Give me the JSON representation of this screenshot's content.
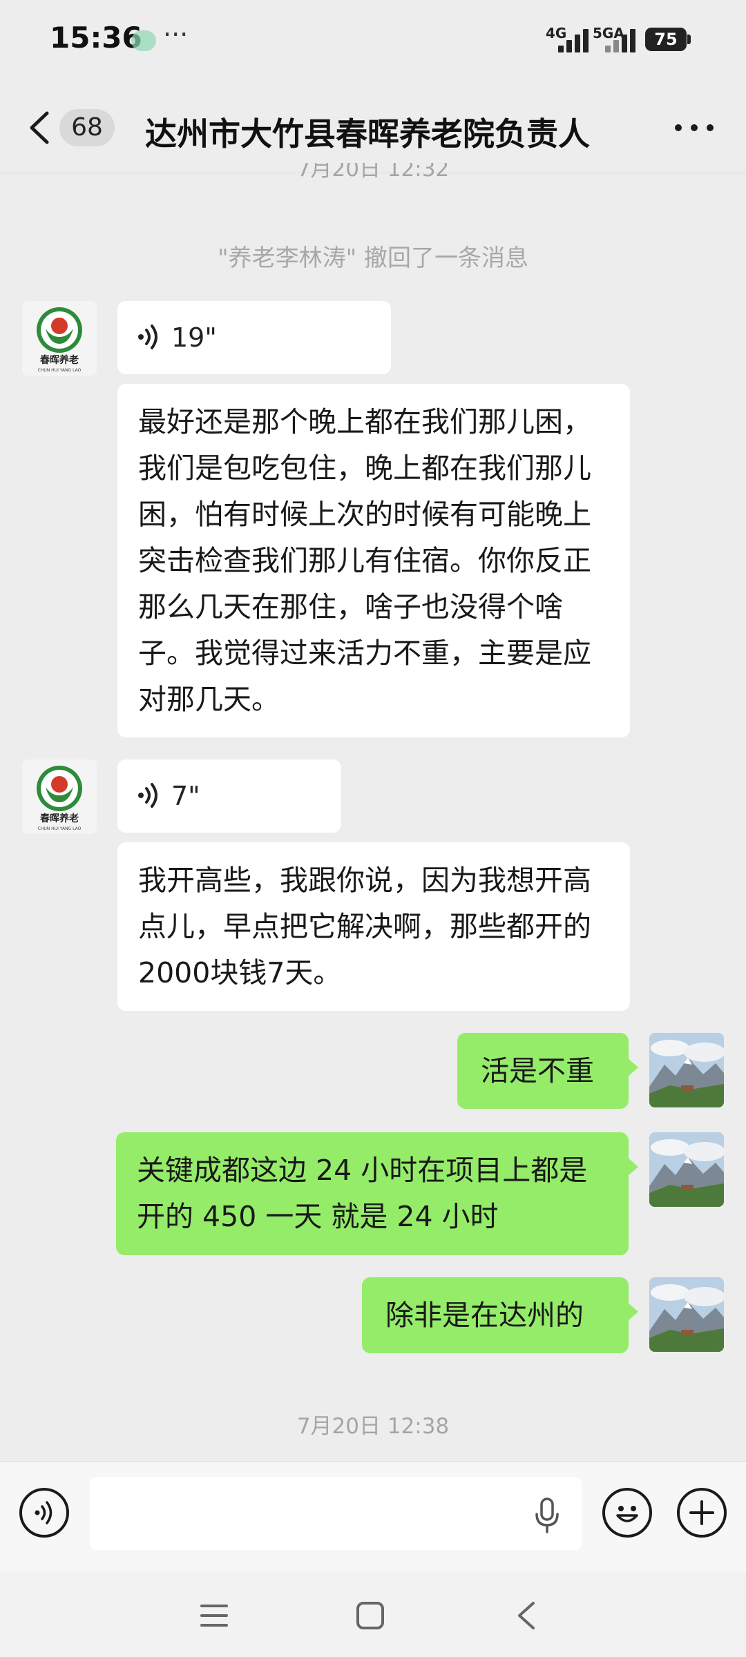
{
  "status_bar": {
    "time": "15:36",
    "more": "···",
    "network_1": "4G",
    "network_2": "5GA",
    "battery": "75"
  },
  "header": {
    "unread_count": "68",
    "title": "达州市大竹县春晖养老院负责人"
  },
  "chat": {
    "partial_timestamp": "7月20日 12:32",
    "recall_notice": "\"养老李林涛\" 撤回了一条消息",
    "messages": [
      {
        "side": "left",
        "type": "voice",
        "duration": "19\""
      },
      {
        "side": "left",
        "type": "text",
        "text": "最好还是那个晚上都在我们那儿困，我们是包吃包住，晚上都在我们那儿困，怕有时候上次的时候有可能晚上突击检查我们那儿有住宿。你你反正那么几天在那住，啥子也没得个啥子。我觉得过来活力不重，主要是应对那几天。"
      },
      {
        "side": "left",
        "type": "voice",
        "duration": "7\""
      },
      {
        "side": "left",
        "type": "text",
        "text": "我开高些，我跟你说，因为我想开高点儿，早点把它解决啊，那些都开的2000块钱7天。"
      },
      {
        "side": "right",
        "type": "text",
        "text": "活是不重"
      },
      {
        "side": "right",
        "type": "text",
        "text": "关键成都这边 24 小时在项目上都是开的 450 一天 就是 24 小时"
      },
      {
        "side": "right",
        "type": "text",
        "text": "除非是在达州的"
      }
    ],
    "bottom_timestamp": "7月20日 12:38"
  },
  "avatar_text": {
    "line1": "春晖养老",
    "line2": "CHUN HUI YANG LAO"
  },
  "colors": {
    "background": "#ededed",
    "sent_bubble": "#95ec69",
    "received_bubble": "#ffffff",
    "avatar_green": "#2e8b3a",
    "avatar_red": "#d23b2a"
  }
}
